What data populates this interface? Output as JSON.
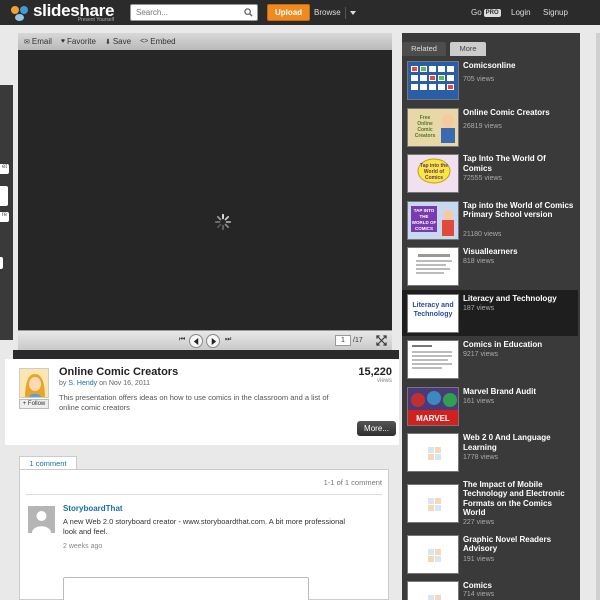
{
  "header": {
    "logo_name": "slideshare",
    "logo_tag": "Present Yourself",
    "search_placeholder": "Search...",
    "upload_label": "Upload",
    "browse_label": "Browse",
    "go_label": "Go",
    "pro_label": "PRO",
    "login_label": "Login",
    "signup_label": "Signup"
  },
  "left_tabs": [
    "et",
    "re"
  ],
  "player": {
    "email_label": "Email",
    "favorite_label": "Favorite",
    "save_label": "Save",
    "embed_label": "Embed",
    "current_page": "1",
    "total_pages": "/17"
  },
  "presentation": {
    "title": "Online Comic Creators",
    "by": "by",
    "author": "S. Hendy",
    "on": "on",
    "date": "Nov 16, 2011",
    "views_count": "15,220",
    "views_label": "views",
    "description": "This presentation offers ideas on how to use comics in the classroom and a list of online comic creators",
    "more_label": "More...",
    "follow_label": "+ Follow"
  },
  "comments": {
    "tab_label": "1 comment",
    "count_label": "1-1 of 1 comment",
    "items": [
      {
        "name": "StoryboardThat",
        "text": "A new Web 2.0 storyboard creator - www.storyboardthat.com. A bit more professional look and feel.",
        "date": "2 weeks ago"
      }
    ]
  },
  "sidebar": {
    "tab_related": "Related",
    "tab_more": "More",
    "items": [
      {
        "title": "Comicsonline",
        "views": "705 views"
      },
      {
        "title": "Online Comic Creators",
        "views": "26819 views"
      },
      {
        "title": "Tap Into The World Of Comics",
        "views": "72555 views"
      },
      {
        "title": "Tap into the World of Comics Primary School version",
        "views": "21180 views"
      },
      {
        "title": "Visuallearners",
        "views": "818 views"
      },
      {
        "title": "Literacy and Technology",
        "views": "187 views"
      },
      {
        "title": "Comics in Education",
        "views": "9217 views"
      },
      {
        "title": "Marvel Brand Audit",
        "views": "161 views"
      },
      {
        "title": "Web 2 0 And Language Learning",
        "views": "1778 views"
      },
      {
        "title": "The Impact of Mobile Technology and Electronic Formats on the Comics World",
        "views": "227 views"
      },
      {
        "title": "Graphic Novel Readers Advisory",
        "views": "191 views"
      },
      {
        "title": "Comics",
        "views": "714 views"
      }
    ],
    "thumb_text": {
      "online_comic_creators": "Free Online Comic Creators",
      "tap_into": "Tap into the World of Comics",
      "tap_into_primary": "TAP INTO THE WORLD OF COMICS",
      "literacy": "Literacy and Technology",
      "marvel": "MARVEL"
    }
  }
}
